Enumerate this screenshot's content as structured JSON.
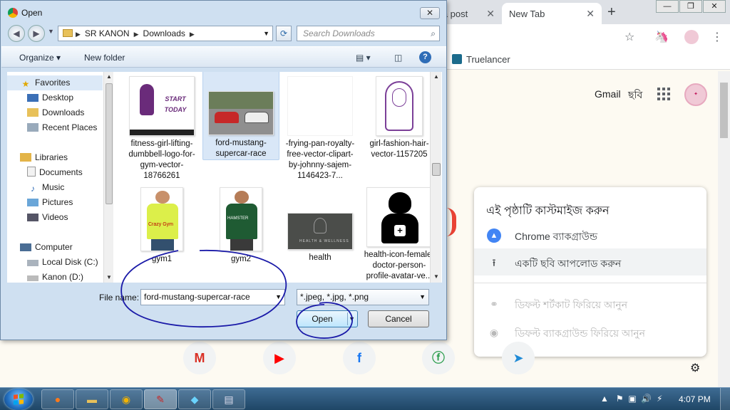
{
  "browser": {
    "tabs": [
      {
        "label": "e a post"
      },
      {
        "label": "New Tab"
      }
    ],
    "bookmark": "Truelancer",
    "gmail_link": "Gmail",
    "images_link": "ছবি",
    "customize_panel": {
      "title": "এই পৃষ্ঠাটি কাস্টমাইজ করুন",
      "items": [
        {
          "label": "Chrome ব্যাকগ্রাউন্ড"
        },
        {
          "label": "একটি ছবি আপলোড করুন"
        },
        {
          "label": "ডিফল্ট শর্টকাট ফিরিয়ে আনুন"
        },
        {
          "label": "ডিফল্ট ব্যাকগ্রাউন্ড ফিরিয়ে আনুন"
        }
      ]
    },
    "shortcuts": [
      "M",
      "▶",
      "f",
      "ⓕ",
      "➤"
    ],
    "colors": {
      "tabstrip": "#dee1e6",
      "accent": "#4285f4"
    }
  },
  "dialog": {
    "title": "Open",
    "breadcrumb": [
      "SR KANON",
      "Downloads"
    ],
    "search_placeholder": "Search Downloads",
    "toolbar": {
      "organize": "Organize",
      "new_folder": "New folder"
    },
    "nav": [
      {
        "label": "Favorites",
        "icon": "star-icon"
      },
      {
        "label": "Desktop",
        "icon": "desktop-icon"
      },
      {
        "label": "Downloads",
        "icon": "downloads-folder-icon"
      },
      {
        "label": "Recent Places",
        "icon": "recent-places-icon"
      },
      {
        "label": "Libraries",
        "icon": "libraries-icon"
      },
      {
        "label": "Documents",
        "icon": "documents-icon"
      },
      {
        "label": "Music",
        "icon": "music-icon"
      },
      {
        "label": "Pictures",
        "icon": "pictures-icon"
      },
      {
        "label": "Videos",
        "icon": "videos-icon"
      },
      {
        "label": "Computer",
        "icon": "computer-icon"
      },
      {
        "label": "Local Disk (C:)",
        "icon": "local-disk-icon"
      },
      {
        "label": "Kanon (D:)",
        "icon": "drive-icon"
      }
    ],
    "files": [
      {
        "name": "fitness-girl-lifting-dumbbell-logo-for-gym-vector-18766261",
        "thumb_text": "START TODAY"
      },
      {
        "name": "ford-mustang-supercar-race",
        "selected": true
      },
      {
        "name": "-frying-pan-royalty-free-vector-clipart-by-johnny-sajem-1146423-7..."
      },
      {
        "name": "girl-fashion-hair-vector-1157205"
      },
      {
        "name": "gym1",
        "thumb_text": "Crazy Gym"
      },
      {
        "name": "gym2",
        "thumb_text": "HAMSTER"
      },
      {
        "name": "health",
        "thumb_text": "HEALTH & WELLNESS"
      },
      {
        "name": "health-icon-female-doctor-person-profile-avatar-ve..."
      }
    ],
    "file_name_label": "File name:",
    "file_name_value": "ford-mustang-supercar-race",
    "file_type": "*.jpeg, *.jpg, *.png",
    "open_label": "Open",
    "cancel_label": "Cancel"
  },
  "taskbar": {
    "clock": "4:07 PM"
  }
}
